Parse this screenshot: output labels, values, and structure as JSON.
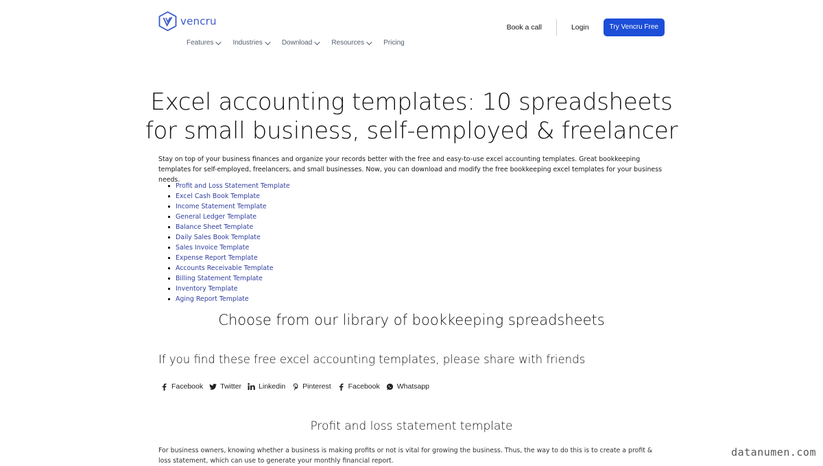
{
  "brand": {
    "name": "vencru",
    "accent": "#1d4ed8",
    "logo_color": "#3a5ac8",
    "link_color": "#2f3e9e"
  },
  "nav": {
    "items": [
      {
        "label": "Features",
        "dropdown": true
      },
      {
        "label": "Industries",
        "dropdown": true
      },
      {
        "label": "Download",
        "dropdown": true
      },
      {
        "label": "Resources",
        "dropdown": true
      },
      {
        "label": "Pricing",
        "dropdown": false
      }
    ]
  },
  "actions": {
    "book_call": "Book a call",
    "login": "Login",
    "try_free": "Try Vencru Free"
  },
  "page": {
    "title_line1": "Excel accounting templates: 10 spreadsheets",
    "title_line2": "for small business, self-employed & freelancer",
    "intro": "Stay on top of your business finances and organize your records better with the free and easy-to-use excel accounting templates. Great bookkeeping templates for self-employed, freelancers, and small businesses.  Now, you can download and modify the free bookkeeping excel templates for your business needs.",
    "templates": [
      "Profit and Loss Statement Template",
      "Excel Cash Book Template",
      "Income Statement Template",
      "General Ledger Template",
      "Balance Sheet Template",
      "Daily Sales Book Template",
      "Sales Invoice Template",
      "Expense Report Template",
      "Accounts Receivable Template",
      "Billing Statement Template",
      "Inventory Template",
      "Aging Report Template"
    ],
    "library_heading": "Choose from our library of bookkeeping spreadsheets",
    "share_heading": "If you find these free excel accounting templates, please share with friends",
    "share": [
      {
        "icon": "facebook-icon",
        "label": "Facebook"
      },
      {
        "icon": "twitter-icon",
        "label": "Twitter"
      },
      {
        "icon": "linkedin-icon",
        "label": "Linkedin"
      },
      {
        "icon": "pinterest-icon",
        "label": "Pinterest"
      },
      {
        "icon": "facebook-icon",
        "label": "Facebook"
      },
      {
        "icon": "whatsapp-icon",
        "label": "Whatsapp"
      }
    ],
    "section_heading": "Profit and loss statement template",
    "section_body": "For business owners, knowing whether a business is making profits or not is vital for growing the business. Thus, the way to do this is to create a profit & loss statement, which can use to generate your monthly financial report."
  },
  "watermark": "datanumen.com"
}
